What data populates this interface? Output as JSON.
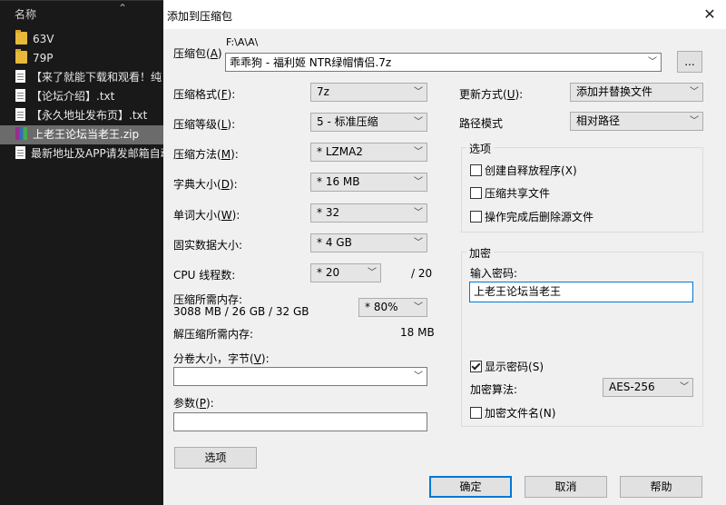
{
  "explorer": {
    "header": "名称",
    "files": [
      {
        "name": "63V",
        "type": "folder",
        "selected": false
      },
      {
        "name": "79P",
        "type": "folder",
        "selected": false
      },
      {
        "name": "【来了就能下载和观看！纯",
        "type": "txt",
        "selected": false
      },
      {
        "name": "【论坛介绍】.txt",
        "type": "txt",
        "selected": false
      },
      {
        "name": "【永久地址发布页】.txt",
        "type": "txt",
        "selected": false
      },
      {
        "name": "上老王论坛当老王.zip",
        "type": "zip",
        "selected": true
      },
      {
        "name": "最新地址及APP请发邮箱自动",
        "type": "txt",
        "selected": false
      }
    ]
  },
  "dialog": {
    "title": "添加到压缩包",
    "close": "✕",
    "archive": {
      "label": "压缩包",
      "key": "A",
      "path": "F:\\A\\A\\",
      "value": "乖乖狗 - 福利姬 NTR绿帽情侣.7z",
      "browse": "..."
    },
    "format": {
      "label": "压缩格式",
      "key": "F",
      "value": "7z"
    },
    "level": {
      "label": "压缩等级",
      "key": "L",
      "value": "5 - 标准压缩"
    },
    "method": {
      "label": "压缩方法",
      "key": "M",
      "value": "* LZMA2"
    },
    "dict": {
      "label": "字典大小",
      "key": "D",
      "value": "* 16 MB"
    },
    "word": {
      "label": "单词大小",
      "key": "W",
      "value": "* 32"
    },
    "solid": {
      "label": "固实数据大小",
      "key": "",
      "value": "* 4 GB"
    },
    "threads": {
      "label": "CPU 线程数",
      "key": "",
      "value": "* 20",
      "max": "/ 20"
    },
    "memory": {
      "label": "压缩所需内存",
      "detail": "3088 MB / 26 GB / 32 GB",
      "value": "* 80%"
    },
    "decomp": {
      "label": "解压缩所需内存",
      "value": "18 MB"
    },
    "volume": {
      "label": "分卷大小，字节",
      "key": "V",
      "value": ""
    },
    "params": {
      "label": "参数",
      "key": "P",
      "value": ""
    },
    "options_btn": "选项",
    "update": {
      "label": "更新方式",
      "key": "U",
      "value": "添加并替换文件"
    },
    "path_mode": {
      "label": "路径模式",
      "value": "相对路径"
    },
    "options_group": {
      "title": "选项",
      "items": [
        {
          "label": "创建自释放程序",
          "key": "X",
          "checked": false
        },
        {
          "label": "压缩共享文件",
          "key": "",
          "checked": false
        },
        {
          "label": "操作完成后删除源文件",
          "key": "",
          "checked": false
        }
      ]
    },
    "encrypt": {
      "title": "加密",
      "pwd_label": "输入密码",
      "pwd_value": "上老王论坛当老王",
      "show_pwd": {
        "label": "显示密码",
        "key": "S",
        "checked": true
      },
      "algo_label": "加密算法",
      "algo_value": "AES-256",
      "encrypt_names": {
        "label": "加密文件名",
        "key": "N",
        "checked": false
      }
    },
    "buttons": {
      "ok": "确定",
      "cancel": "取消",
      "help": "帮助"
    }
  }
}
